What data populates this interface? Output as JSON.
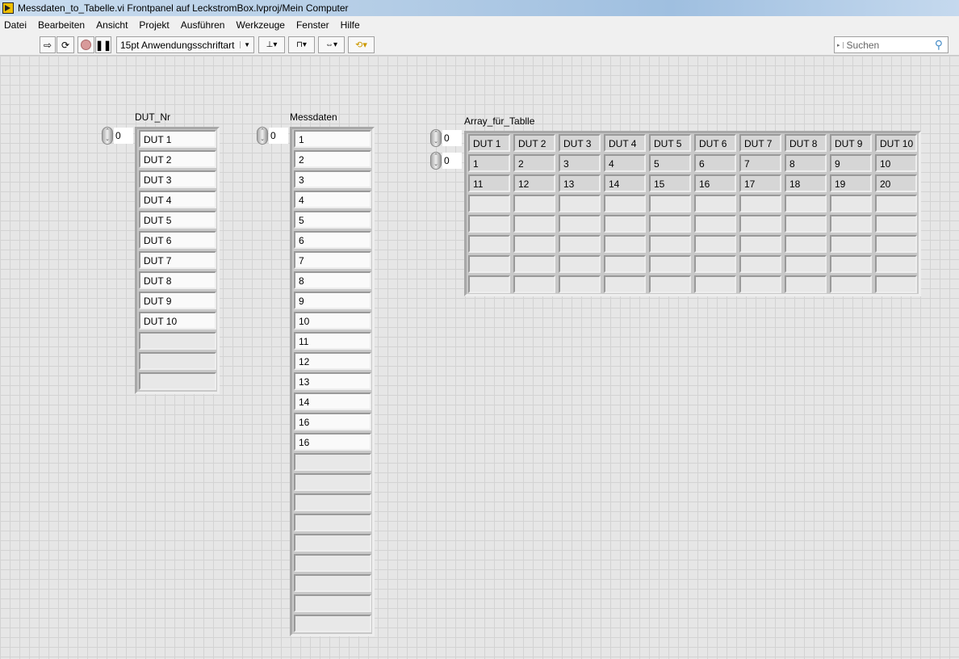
{
  "window": {
    "title": "Messdaten_to_Tabelle.vi Frontpanel auf LeckstromBox.lvproj/Mein Computer"
  },
  "menu": [
    "Datei",
    "Bearbeiten",
    "Ansicht",
    "Projekt",
    "Ausführen",
    "Werkzeuge",
    "Fenster",
    "Hilfe"
  ],
  "toolbar": {
    "font": "15pt Anwendungsschriftart",
    "search_placeholder": "Suchen",
    "icons": [
      "run-arrow-icon",
      "run-continuously-icon",
      "abort-icon",
      "pause-icon",
      "align-icon",
      "distribute-icon",
      "resize-icon",
      "reorder-icon"
    ]
  },
  "dut_nr": {
    "label": "DUT_Nr",
    "index": "0",
    "values": [
      "DUT 1",
      "DUT 2",
      "DUT 3",
      "DUT 4",
      "DUT 5",
      "DUT 6",
      "DUT 7",
      "DUT 8",
      "DUT 9",
      "DUT 10"
    ],
    "empty": 3
  },
  "messdaten": {
    "label": "Messdaten",
    "index": "0",
    "values": [
      "1",
      "2",
      "3",
      "4",
      "5",
      "6",
      "7",
      "8",
      "9",
      "10",
      "11",
      "12",
      "13",
      "14",
      "16",
      "16"
    ],
    "empty": 9
  },
  "table": {
    "label": "Array_für_Tablle",
    "row_index": "0",
    "col_index": "0",
    "rows": [
      [
        "DUT 1",
        "DUT 2",
        "DUT 3",
        "DUT 4",
        "DUT 5",
        "DUT 6",
        "DUT 7",
        "DUT 8",
        "DUT 9",
        "DUT 10"
      ],
      [
        "1",
        "2",
        "3",
        "4",
        "5",
        "6",
        "7",
        "8",
        "9",
        "10"
      ],
      [
        "11",
        "12",
        "13",
        "14",
        "15",
        "16",
        "17",
        "18",
        "19",
        "20"
      ]
    ],
    "empty_rows": 5
  }
}
